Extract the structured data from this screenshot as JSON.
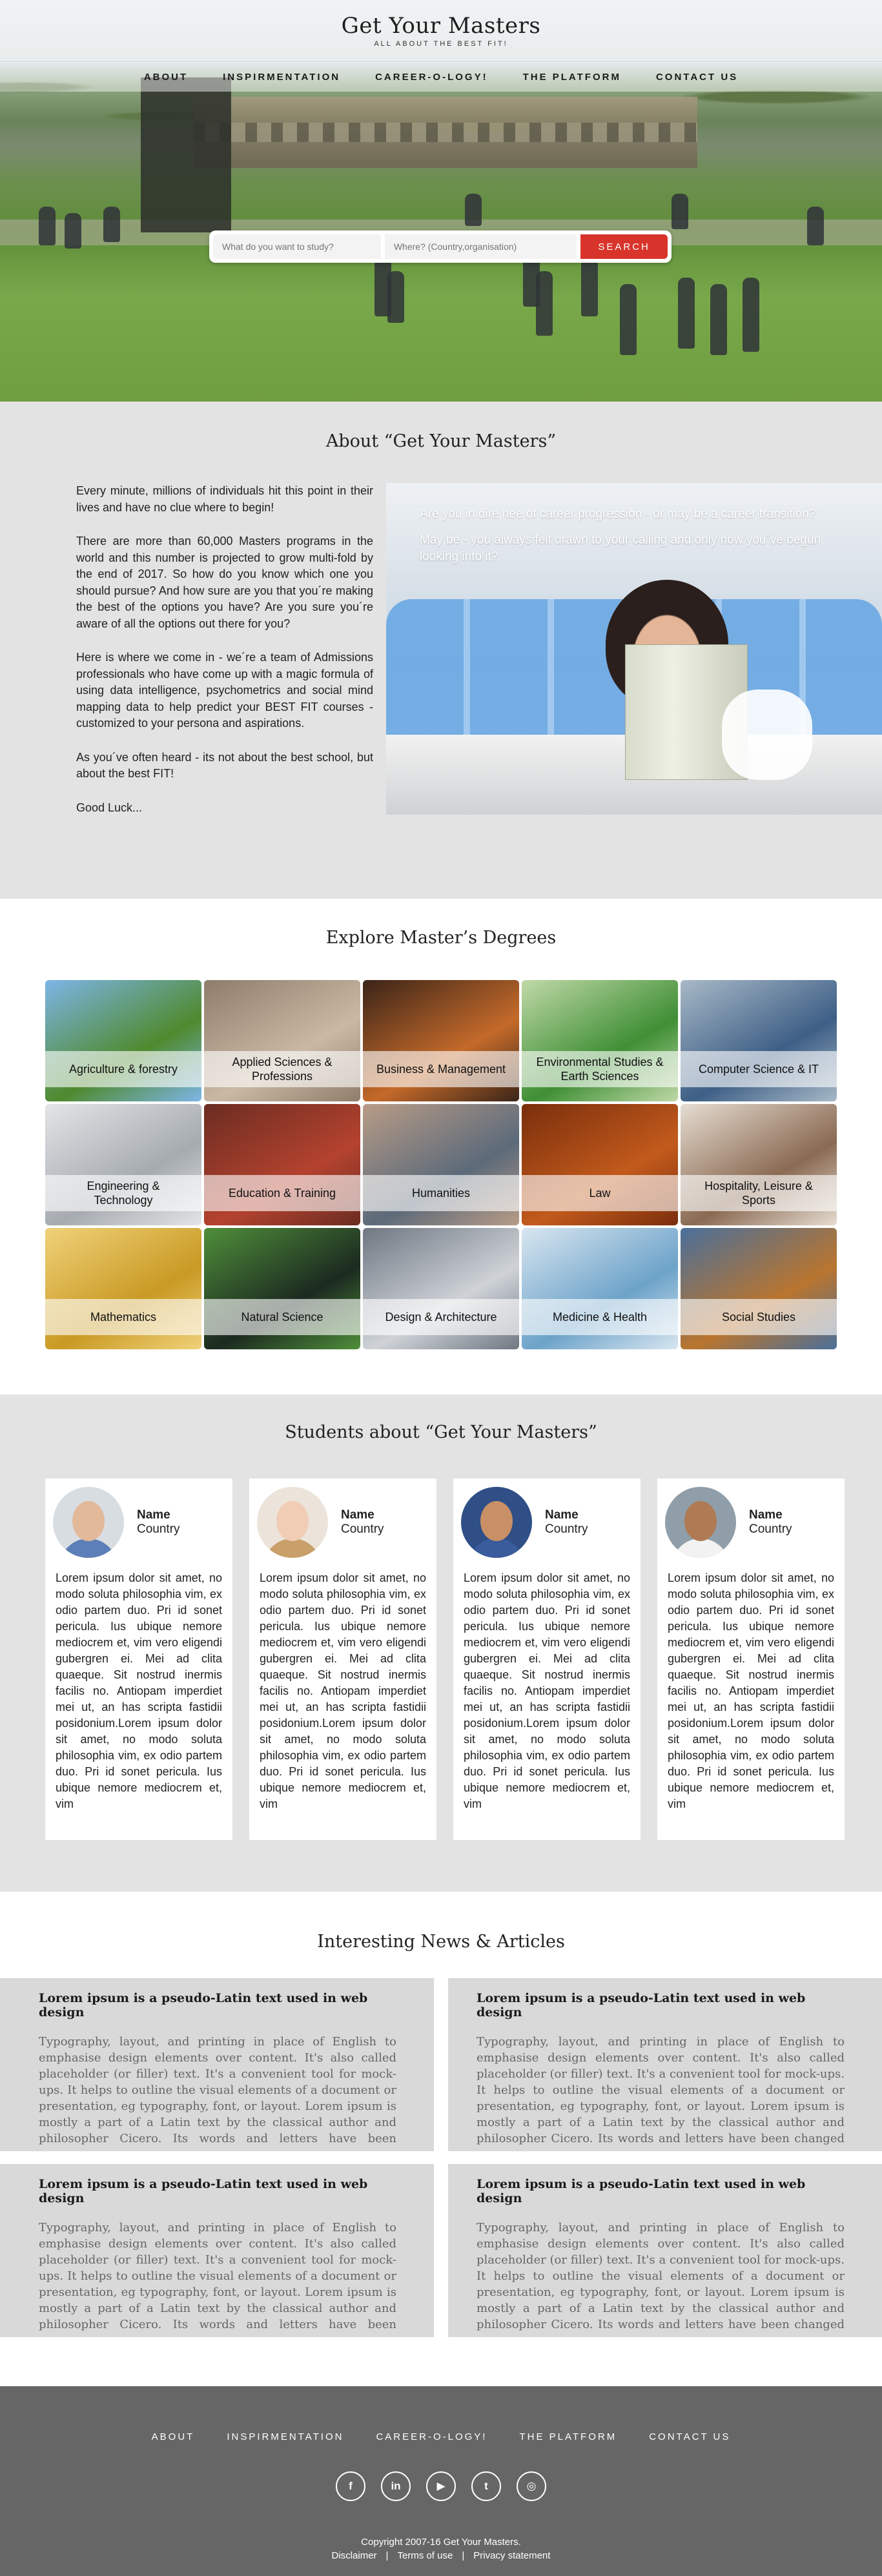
{
  "brand": {
    "title": "Get Your Masters",
    "tagline": "ALL ABOUT THE BEST FIT!"
  },
  "nav": [
    "ABOUT",
    "INSPIRMENTATION",
    "CAREER-O-LOGY!",
    "THE PLATFORM",
    "CONTACT US"
  ],
  "search": {
    "study_placeholder": "What do you want to study?",
    "location_placeholder": "Where? (Country,organisation)",
    "button": "SEARCH"
  },
  "about": {
    "title": "About “Get Your Masters”",
    "paragraphs": [
      "Every minute, millions of individuals hit this point in their lives and have no clue where to begin!",
      "There are more than 60,000 Masters programs in the world and this number is projected to grow multi-fold by the end of 2017. So how do you know which one you should pursue? And how sure are you that you´re making the best of the options you have? Are you sure you´re aware of all the options out there for you?",
      "Here is where we come in - we´re a team of Admissions professionals who have come up with a magic formula of using data intelligence, psychometrics and social mind mapping data to help predict your BEST FIT courses - customized to your persona and aspirations.",
      "As you´ve often heard - its not about the best school, but about the best FIT!",
      "Good Luck..."
    ],
    "overlay": [
      "Are you in dire nee of career progression - or may be a career transition?",
      "May be - you always felt drawn to your calling and only now you´ve begun looking into it?"
    ]
  },
  "degrees": {
    "title": "Explore Master’s Degrees",
    "items": [
      {
        "label": "Agriculture & forestry",
        "bg": "#4f8a2e",
        "bg2": "#7db5e8"
      },
      {
        "label": "Applied Sciences & Professions",
        "bg": "#c9b9a4",
        "bg2": "#8f7d6b"
      },
      {
        "label": "Business & Management",
        "bg": "#c46a2a",
        "bg2": "#3a2418"
      },
      {
        "label": "Environmental Studies & Earth Sciences",
        "bg": "#3f8f35",
        "bg2": "#c0d9a8"
      },
      {
        "label": "Computer Science & IT",
        "bg": "#3e5f86",
        "bg2": "#a8b9c7"
      },
      {
        "label": "Engineering & Technology",
        "bg": "#a6abb0",
        "bg2": "#e3e5e7"
      },
      {
        "label": "Education & Training",
        "bg": "#b4422f",
        "bg2": "#6b2d21"
      },
      {
        "label": "Humanities",
        "bg": "#5c6a7a",
        "bg2": "#b89c86"
      },
      {
        "label": "Law",
        "bg": "#c25a1c",
        "bg2": "#7a2e0c"
      },
      {
        "label": "Hospitality, Leisure & Sports",
        "bg": "#8a6a52",
        "bg2": "#e6ddd2"
      },
      {
        "label": "Mathematics",
        "bg": "#c99a24",
        "bg2": "#f0d27a"
      },
      {
        "label": "Natural Science",
        "bg": "#1c2a20",
        "bg2": "#4f8f3a"
      },
      {
        "label": "Design & Architecture",
        "bg": "#cfd3d8",
        "bg2": "#6f7782"
      },
      {
        "label": "Medicine & Health",
        "bg": "#6da3c9",
        "bg2": "#d8e6f0"
      },
      {
        "label": "Social Studies",
        "bg": "#b9752f",
        "bg2": "#4a6f9a"
      }
    ]
  },
  "students": {
    "title": "Students about “Get Your Masters”",
    "cards": [
      {
        "name": "Name",
        "country": "Country",
        "skin": "#e2b999",
        "shirt": "#5d7fb7",
        "bgcol": "#d8dde2",
        "quote": "Lorem ipsum dolor sit amet, no modo soluta philosophia vim, ex odio partem duo. Pri id sonet pericula. Ius ubique nemore mediocrem et, vim vero eligendi gubergren ei. Mei ad clita quaeque. Sit nostrud inermis facilis no. Antiopam imperdiet mei ut, an has scripta fastidii posidonium.Lorem ipsum dolor sit amet, no modo soluta philosophia vim, ex odio partem duo. Pri id sonet pericula. Ius ubique nemore mediocrem et, vim"
      },
      {
        "name": "Name",
        "country": "Country",
        "skin": "#f0cdb4",
        "shirt": "#c9a06a",
        "bgcol": "#ece4da",
        "quote": "Lorem ipsum dolor sit amet, no modo soluta philosophia vim, ex odio partem duo. Pri id sonet pericula. Ius ubique nemore mediocrem et, vim vero eligendi gubergren ei. Mei ad clita quaeque. Sit nostrud inermis facilis no. Antiopam imperdiet mei ut, an has scripta fastidii posidonium.Lorem ipsum dolor sit amet, no modo soluta philosophia vim, ex odio partem duo. Pri id sonet pericula. Ius ubique nemore mediocrem et, vim"
      },
      {
        "name": "Name",
        "country": "Country",
        "skin": "#c98f66",
        "shirt": "#3a5c9c",
        "bgcol": "#2f4f86",
        "quote": "Lorem ipsum dolor sit amet, no modo soluta philosophia vim, ex odio partem duo. Pri id sonet pericula. Ius ubique nemore mediocrem et, vim vero eligendi gubergren ei. Mei ad clita quaeque. Sit nostrud inermis facilis no. Antiopam imperdiet mei ut, an has scripta fastidii posidonium.Lorem ipsum dolor sit amet, no modo soluta philosophia vim, ex odio partem duo. Pri id sonet pericula. Ius ubique nemore mediocrem et, vim"
      },
      {
        "name": "Name",
        "country": "Country",
        "skin": "#b07a55",
        "shirt": "#f2f2f2",
        "bgcol": "#8f9ea8",
        "quote": "Lorem ipsum dolor sit amet, no modo soluta philosophia vim, ex odio partem duo. Pri id sonet pericula. Ius ubique nemore mediocrem et, vim vero eligendi gubergren ei. Mei ad clita quaeque. Sit nostrud inermis facilis no. Antiopam imperdiet mei ut, an has scripta fastidii posidonium.Lorem ipsum dolor sit amet, no modo soluta philosophia vim, ex odio partem duo. Pri id sonet pericula. Ius ubique nemore mediocrem et, vim"
      }
    ]
  },
  "news": {
    "title": "Interesting News & Articles",
    "articles": [
      {
        "title": "Lorem ipsum is a pseudo-Latin text used in web design",
        "body": "Typography, layout, and printing in place of English to emphasise design elements over content. It's also called placeholder (or filler) text. It's a convenient tool for mock-ups. It helps to outline the visual elements of a document or presentation, eg typography, font, or layout. Lorem ipsum is mostly a part of a Latin text by the classical author and philosopher Cicero. Its words and letters have been changed by addition or removal, so"
      },
      {
        "title": "Lorem ipsum is a pseudo-Latin text used in web design",
        "body": "Typography, layout, and printing in place of English to emphasise design elements over content. It's also called placeholder (or filler) text. It's a convenient tool for mock-ups. It helps to outline the visual elements of a document or presentation, eg typography, font, or layout. Lorem ipsum is mostly a part of a Latin text by the classical author and philosopher Cicero. Its words and letters have been changed by addition or removal, so"
      },
      {
        "title": "Lorem ipsum is a pseudo-Latin text used in web design",
        "body": "Typography, layout, and printing in place of English to emphasise design elements over content. It's also called placeholder (or filler) text. It's a convenient tool for mock-ups. It helps to outline the visual elements of a document or presentation, eg typography, font, or layout. Lorem ipsum is mostly a part of a Latin text by the classical author and philosopher Cicero. Its words and letters have been changed by addition or removal, so"
      },
      {
        "title": "Lorem ipsum is a pseudo-Latin text used in web design",
        "body": "Typography, layout, and printing in place of English to emphasise design elements over content. It's also called placeholder (or filler) text. It's a convenient tool for mock-ups. It helps to outline the visual elements of a document or presentation, eg typography, font, or layout. Lorem ipsum is mostly a part of a Latin text by the classical author and philosopher Cicero. Its words and letters have been changed by addition or removal, so"
      }
    ]
  },
  "footer": {
    "nav": [
      "ABOUT",
      "INSPIRMENTATION",
      "CAREER-O-LOGY!",
      "THE PLATFORM",
      "CONTACT US"
    ],
    "social": [
      {
        "icon": "facebook-icon",
        "glyph": "f"
      },
      {
        "icon": "linkedin-icon",
        "glyph": "in"
      },
      {
        "icon": "youtube-icon",
        "glyph": "▶"
      },
      {
        "icon": "twitter-icon",
        "glyph": "t"
      },
      {
        "icon": "instagram-icon",
        "glyph": "◎"
      }
    ],
    "copyright": "Copyright 2007-16 Get Your Masters.",
    "links": [
      "Disclaimer",
      "Terms of use",
      "Privacy statement"
    ],
    "separator": "|"
  },
  "colors": {
    "accent": "#d9342b",
    "section_grey": "#e3e3e3",
    "footer": "#666666"
  }
}
